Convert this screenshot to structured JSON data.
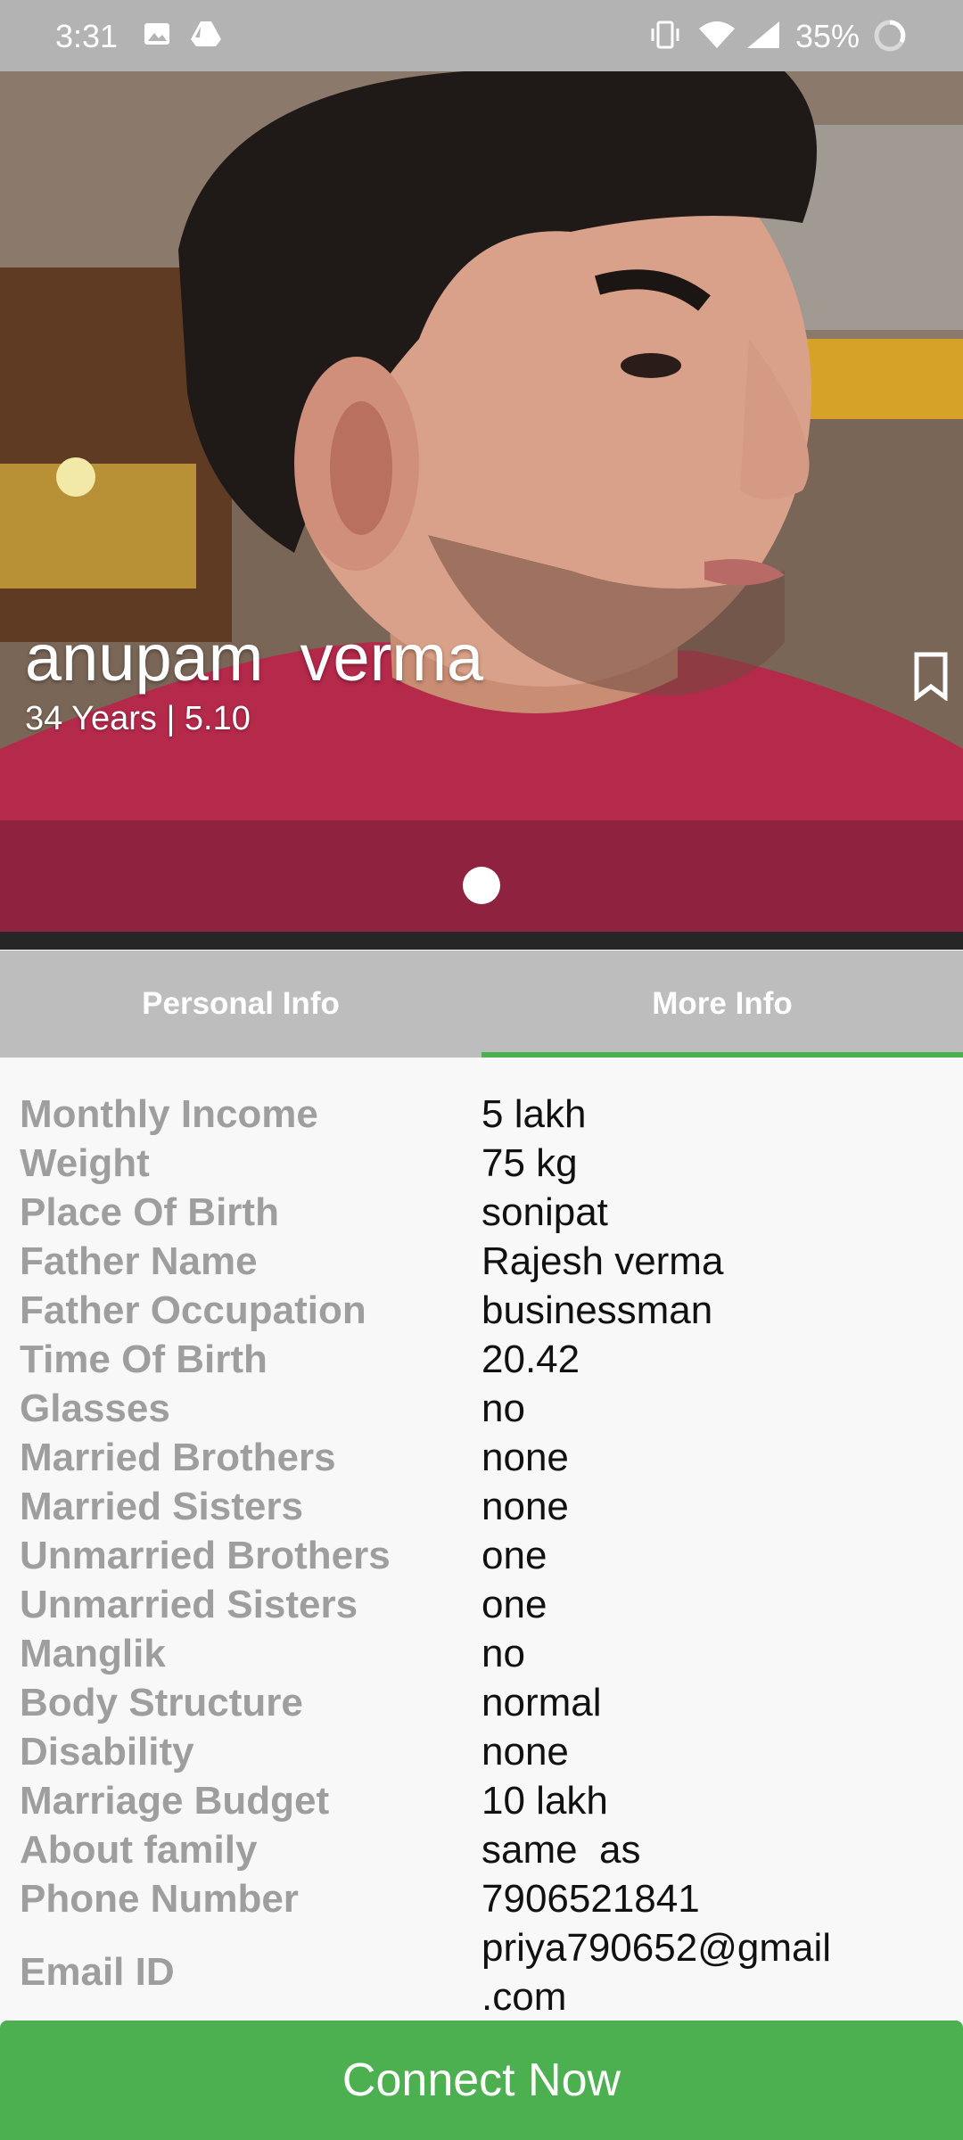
{
  "status_bar": {
    "time": "3:31",
    "battery": "35%",
    "icons": [
      "image-icon",
      "drive-icon",
      "vibrate-icon",
      "wifi-icon",
      "signal-icon",
      "battery-icon"
    ]
  },
  "profile": {
    "name": "anupam  verma",
    "subtitle": "34 Years | 5.10"
  },
  "tabs": [
    {
      "label": "Personal Info",
      "active": false
    },
    {
      "label": "More Info",
      "active": true
    }
  ],
  "info": [
    {
      "label": "Monthly Income",
      "value": "5 lakh"
    },
    {
      "label": "Weight",
      "value": "75 kg"
    },
    {
      "label": "Place Of Birth",
      "value": "sonipat"
    },
    {
      "label": "Father Name",
      "value": "Rajesh verma"
    },
    {
      "label": "Father Occupation",
      "value": "businessman"
    },
    {
      "label": "Time Of Birth",
      "value": "20.42"
    },
    {
      "label": "Glasses",
      "value": "no"
    },
    {
      "label": "Married Brothers",
      "value": "none"
    },
    {
      "label": "Married Sisters",
      "value": "none"
    },
    {
      "label": "Unmarried Brothers",
      "value": "one"
    },
    {
      "label": "Unmarried Sisters",
      "value": "one"
    },
    {
      "label": "Manglik",
      "value": "no"
    },
    {
      "label": "Body Structure",
      "value": "normal"
    },
    {
      "label": "Disability",
      "value": "none"
    },
    {
      "label": "Marriage Budget",
      "value": "10 lakh"
    },
    {
      "label": "About family",
      "value": "same  as"
    },
    {
      "label": "Phone Number",
      "value": "7906521841"
    },
    {
      "label": "Email ID",
      "value": "priya790652@gmail\n.com"
    }
  ],
  "connect_button": {
    "label": "Connect Now"
  },
  "colors": {
    "accent": "#4caf50",
    "tab_bar": "#bdbdbd",
    "label_gray": "#9e9e9e",
    "status_bar": "#b3b3b3"
  }
}
